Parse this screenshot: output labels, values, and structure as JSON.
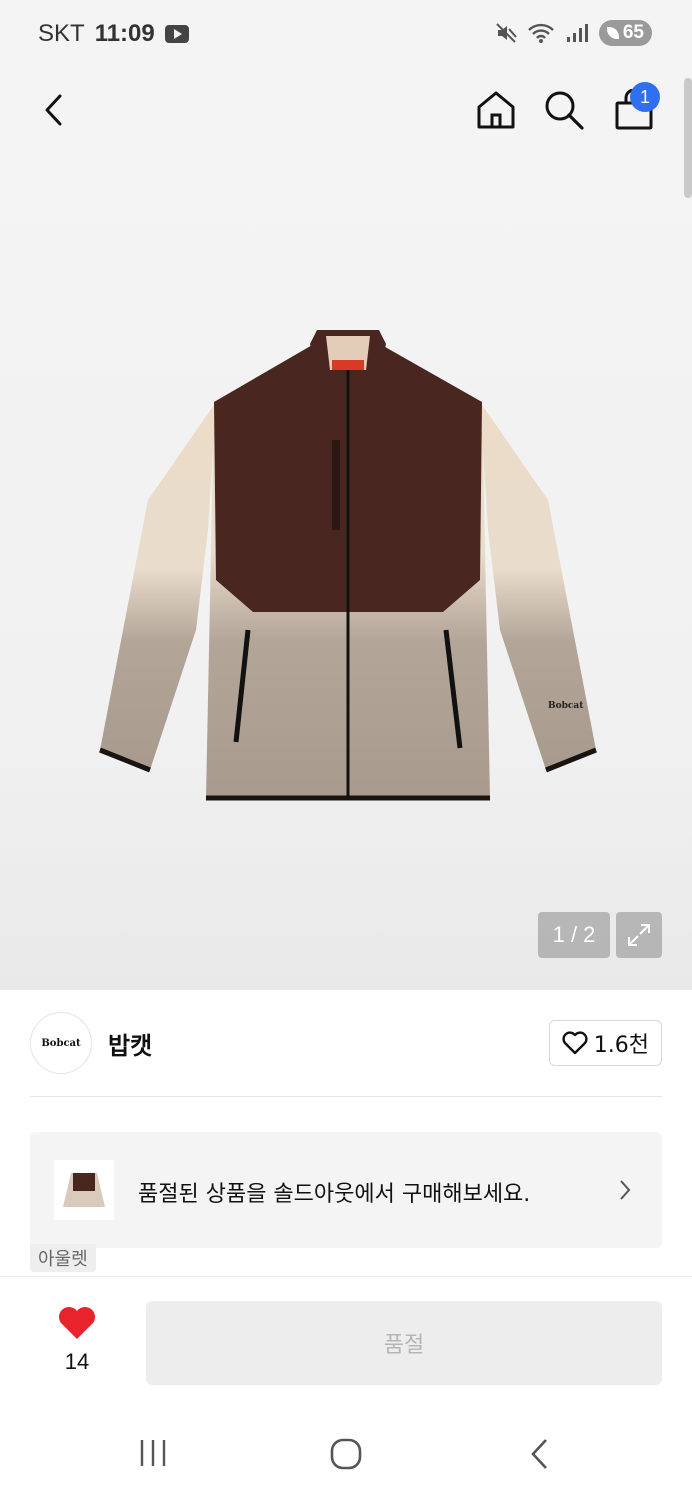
{
  "status_bar": {
    "carrier": "SKT",
    "time": "11:09",
    "battery": "65",
    "icons": [
      "youtube-icon",
      "mute-icon",
      "wifi-icon",
      "signal-icon",
      "battery-icon"
    ]
  },
  "top_nav": {
    "cart_count": "1",
    "icons": [
      "back-arrow-icon",
      "home-icon",
      "search-icon",
      "shopping-bag-icon"
    ]
  },
  "gallery": {
    "pager": "1 / 2",
    "expand_icon": "expand-icon",
    "product_logo_text": "Bobcat"
  },
  "brand": {
    "logo_text": "Bobcat",
    "name": "밥캣",
    "like_count": "1.6천"
  },
  "soldout_banner": {
    "text": "품절된 상품을 솔드아웃에서 구매해보세요.",
    "tag": "아울렛"
  },
  "bottom_bar": {
    "wish_count": "14",
    "action_label": "품절"
  },
  "colors": {
    "accent_blue": "#2f6ff0",
    "heart_red": "#e8232b",
    "disabled_bg": "#ededed"
  }
}
